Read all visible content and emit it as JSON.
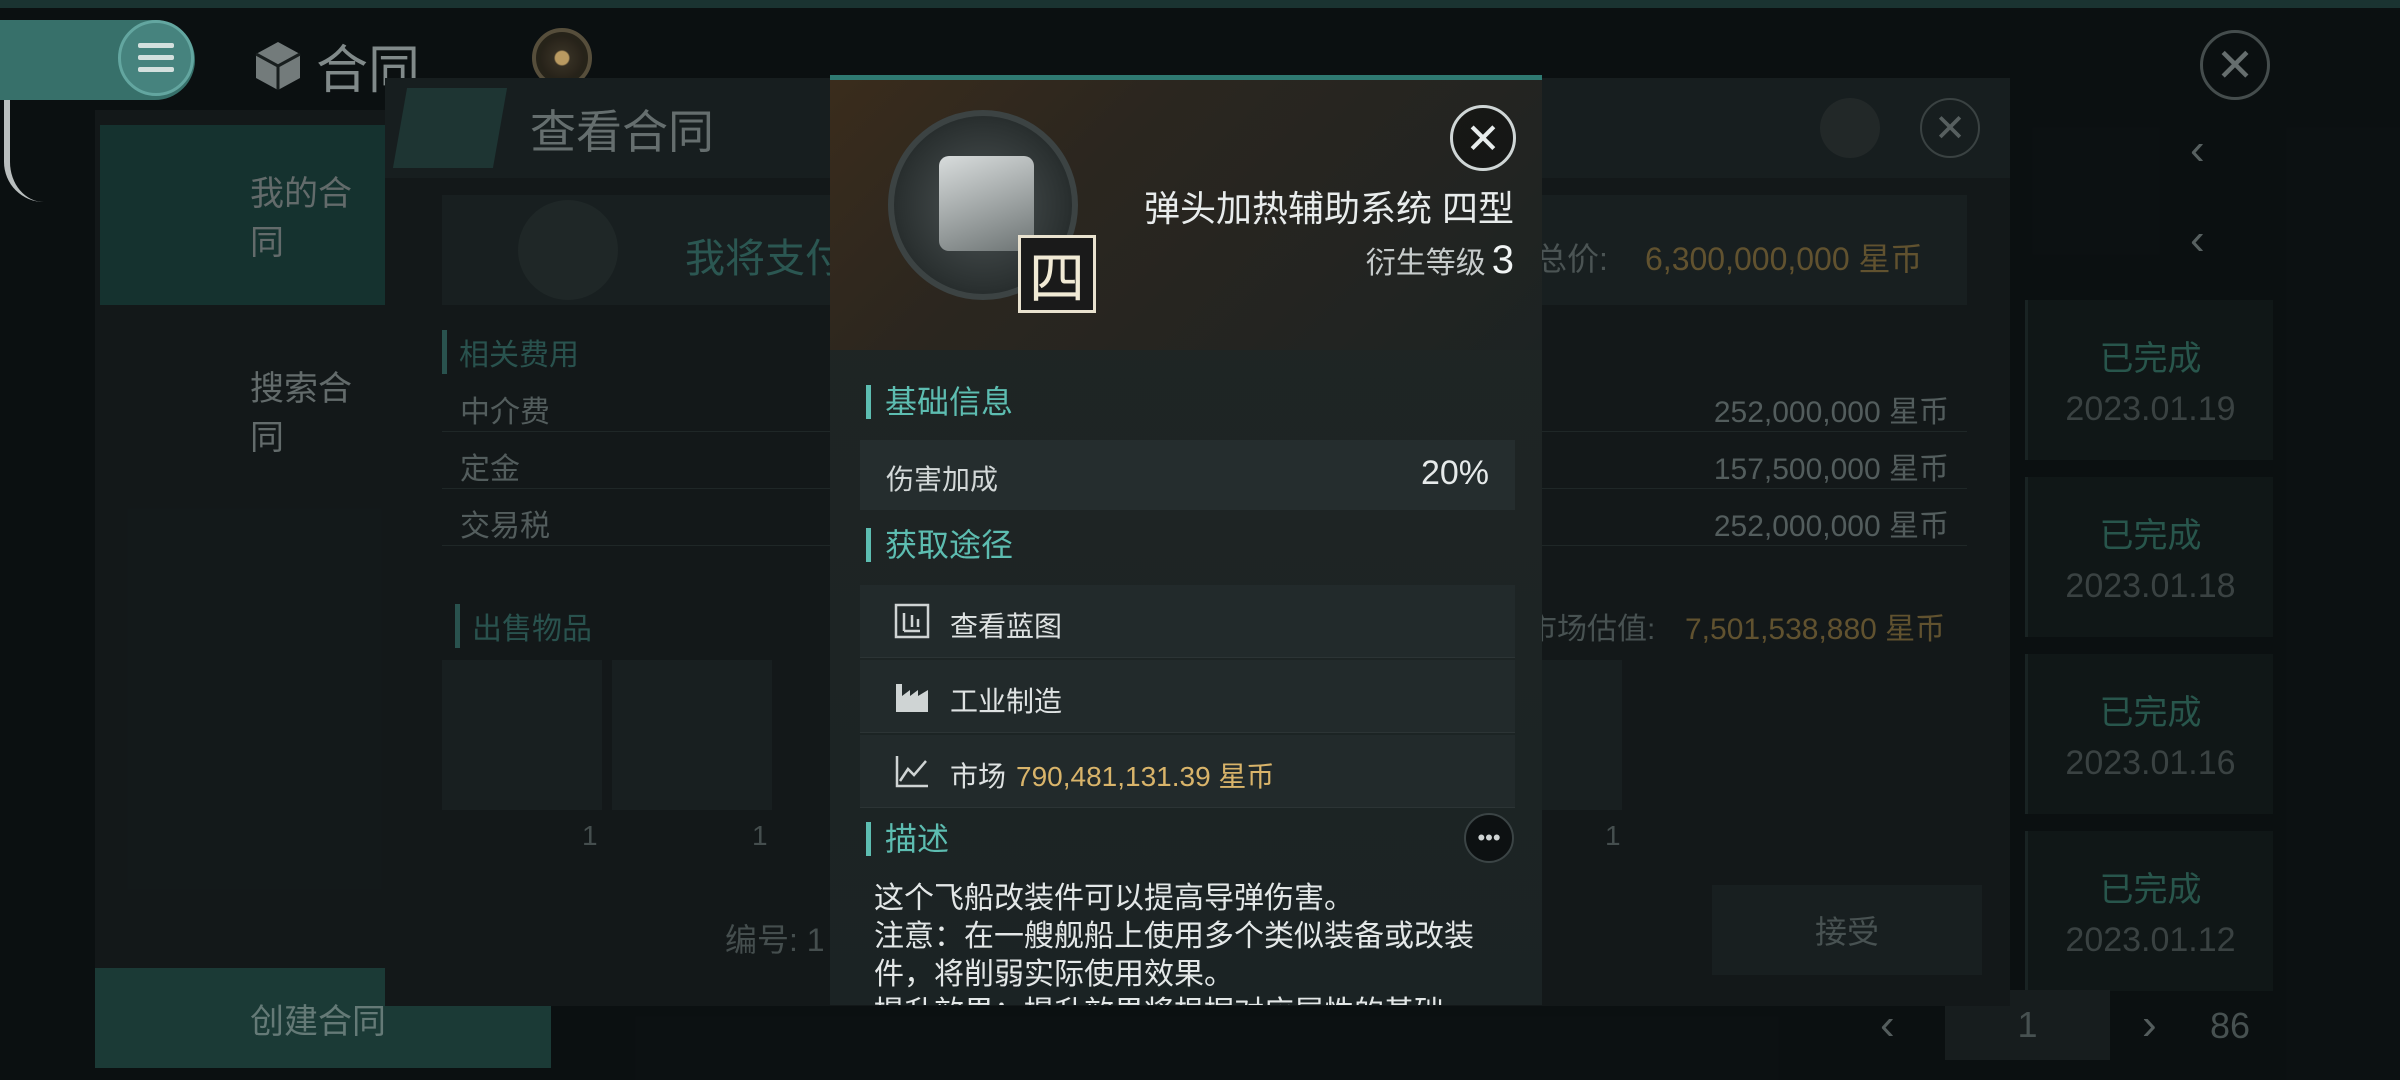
{
  "app": {
    "title": "合同",
    "menu_icon": "menu-icon",
    "close_icon": "close-icon"
  },
  "nav": {
    "items": [
      {
        "label": "我的合同"
      },
      {
        "label": "搜索合同"
      }
    ],
    "create_label": "创建合同"
  },
  "contract": {
    "title": "查看合同",
    "pay_label": "我将支付",
    "total_label": "总价:",
    "total_value": "6,300,000,000 星币",
    "fees_title": "相关费用",
    "fees": [
      {
        "name": "中介费",
        "value": "252,000,000 星币"
      },
      {
        "name": "定金",
        "value": "157,500,000 星币"
      },
      {
        "name": "交易税",
        "value": "252,000,000 星币"
      }
    ],
    "items_title": "出售物品",
    "market_est_label": "市场估值:",
    "market_est_value": "7,501,538,880 星币",
    "item_counts": [
      "1",
      "1",
      "1"
    ],
    "serial_label": "编号: 1",
    "accept_label": "接受"
  },
  "status_list": [
    {
      "status": "已完成",
      "date": "2023.01.19"
    },
    {
      "status": "已完成",
      "date": "2023.01.18"
    },
    {
      "status": "已完成",
      "date": "2023.01.16"
    },
    {
      "status": "已完成",
      "date": "2023.01.12"
    }
  ],
  "pager": {
    "page": "1",
    "total": "86"
  },
  "modal": {
    "item_name": "弹头加热辅助系统 四型",
    "grade_badge": "四",
    "level_label": "衍生等级",
    "level_value": "3",
    "basic_title": "基础信息",
    "stat_label": "伤害加成",
    "stat_value": "20%",
    "source_title": "获取途径",
    "sources": [
      {
        "label": "查看蓝图",
        "icon": "blueprint-icon"
      },
      {
        "label": "工业制造",
        "icon": "factory-icon"
      },
      {
        "label": "市场",
        "icon": "market-chart-icon"
      }
    ],
    "market_price": "790,481,131.39 星币",
    "desc_title": "描述",
    "more_label": "•••",
    "desc_lines": [
      "这个飞船改装件可以提高导弹伤害。",
      "注意：在一艘舰船上使用多个类似装备或改装件，将削弱实际使用效果。",
      "提升效果：提升效果将根据对应属性的基础"
    ]
  },
  "colors": {
    "accent": "#5dbdb1",
    "gold": "#d9b46a",
    "status_done": "#2c5e53"
  }
}
